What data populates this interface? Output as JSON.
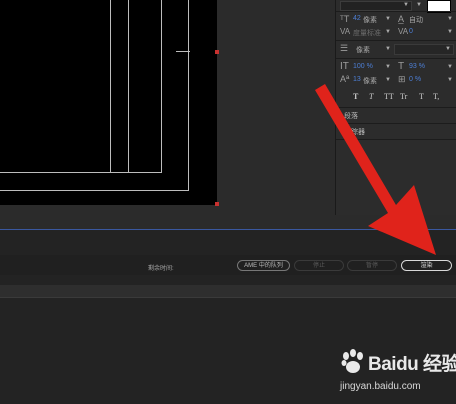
{
  "character": {
    "font_size_value": "42",
    "font_size_unit": "像素",
    "leading_value": "自动",
    "tracking_label": "度量标准",
    "kerning_value": "0",
    "stroke_width_unit": "像素",
    "vertical_scale": "100 %",
    "horizontal_scale": "93 %",
    "baseline_shift_value": "13",
    "baseline_shift_unit": "像素",
    "tsume_value": "0 %",
    "style_buttons": [
      "T",
      "T",
      "TT",
      "Tr",
      "T",
      "T,"
    ]
  },
  "panels": {
    "paragraph": "段落",
    "tracker": "跟踪器"
  },
  "render_queue": {
    "remaining_time_label": "剩余时间:",
    "ame_button": "AME 中的队列",
    "stop_button": "停止",
    "pause_button": "暂停",
    "render_button": "渲染"
  },
  "watermark": {
    "text": "Baidu 经验",
    "url": "jingyan.baidu.com"
  },
  "colors": {
    "accent_blue": "#4d7fd6",
    "handle_red": "#c8312f",
    "arrow_red": "#e0231b"
  }
}
